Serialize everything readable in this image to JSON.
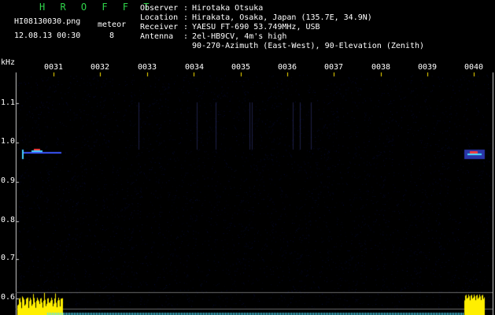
{
  "header": {
    "app_title": "H R O F F T",
    "filename": "HI08130030.png",
    "datetime": "12.08.13 00:30",
    "meteor_label": "meteor",
    "meteor_count": "8"
  },
  "station_info": [
    {
      "key": "Observer",
      "value": "Hirotaka Otsuka"
    },
    {
      "key": "Location",
      "value": "Hirakata, Osaka, Japan (135.7E, 34.9N)"
    },
    {
      "key": "Receiver",
      "value": "YAESU FT-690 53.749MHz, USB"
    },
    {
      "key": "Antenna",
      "value": "2el-HB9CV, 4m's high"
    },
    {
      "key": "",
      "value": "90-270-Azimuth (East-West), 90-Elevation (Zenith)"
    }
  ],
  "y_axis": {
    "unit": "kHz",
    "ticks": [
      "1.1",
      "1.0",
      "0.9",
      "0.8",
      "0.7",
      "0.6"
    ]
  },
  "x_axis": {
    "ticks": [
      "0031",
      "0032",
      "0033",
      "0034",
      "0035",
      "0036",
      "0037",
      "0038",
      "0039",
      "0040"
    ]
  },
  "colors": {
    "background": "#000000",
    "title": "#2fd34a",
    "marker": "#ffe600",
    "signal_blue": "#1f2b8f",
    "signal_red": "#ff3b3b",
    "bar_yellow": "#ffef00",
    "bar_cyan": "#4fe3ff"
  }
}
